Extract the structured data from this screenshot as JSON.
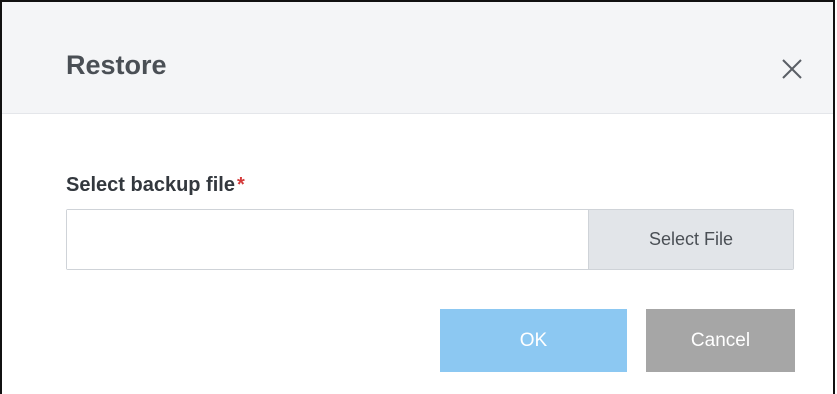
{
  "dialog": {
    "title": "Restore",
    "close_icon": "close-icon"
  },
  "form": {
    "label": "Select backup file",
    "required_marker": "*",
    "file_input_value": "",
    "select_file_label": "Select File"
  },
  "actions": {
    "ok_label": "OK",
    "cancel_label": "Cancel"
  },
  "colors": {
    "header_bg": "#f4f5f7",
    "ok_bg": "#8cc8f2",
    "cancel_bg": "#a6a6a6",
    "required": "#d43a3a"
  }
}
